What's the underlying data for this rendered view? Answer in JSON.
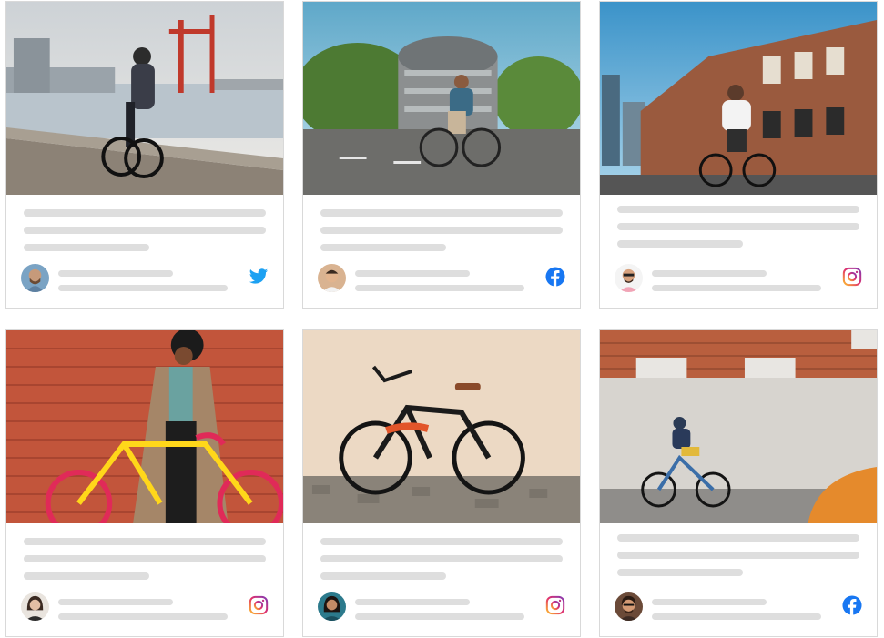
{
  "feed": {
    "cards": [
      {
        "photo": "cyclist-on-harbor-quay",
        "avatar": "man-with-beard-avatar",
        "network": "twitter",
        "network_color": "#1da1f2"
      },
      {
        "photo": "cyclist-on-city-street-dome-building",
        "avatar": "man-avatar",
        "network": "facebook",
        "network_color": "#1877f2"
      },
      {
        "photo": "cyclist-by-brick-building",
        "avatar": "man-with-sunglasses-avatar",
        "network": "instagram",
        "network_color": "#d6249f"
      },
      {
        "photo": "woman-with-yellow-bike-brick-wall",
        "avatar": "woman-avatar",
        "network": "instagram",
        "network_color": "#d6249f"
      },
      {
        "photo": "black-cruiser-bike-against-wall",
        "avatar": "woman-dark-hair-avatar",
        "network": "instagram",
        "network_color": "#d6249f"
      },
      {
        "photo": "boy-cycling-on-street",
        "avatar": "man-with-glasses-avatar",
        "network": "facebook",
        "network_color": "#1877f2"
      }
    ]
  }
}
